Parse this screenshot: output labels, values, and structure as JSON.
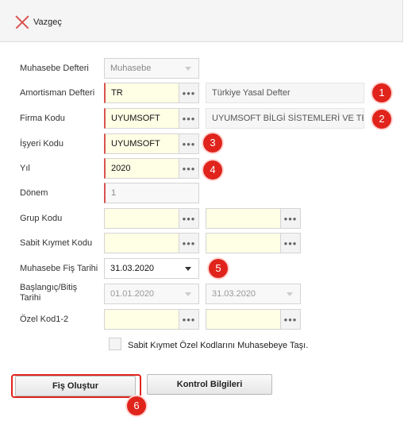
{
  "toolbar": {
    "cancel_label": "Vazgeç"
  },
  "form": {
    "muhasebe_defteri": {
      "label": "Muhasebe Defteri",
      "value": "Muhasebe"
    },
    "amortisman_defteri": {
      "label": "Amortisman Defteri",
      "value": "TR",
      "description": "Türkiye Yasal Defter"
    },
    "firma_kodu": {
      "label": "Firma Kodu",
      "value": "UYUMSOFT",
      "description": "UYUMSOFT BİLGİ SİSTEMLERİ VE TEKNO"
    },
    "isyeri_kodu": {
      "label": "İşyeri Kodu",
      "value": "UYUMSOFT"
    },
    "yil": {
      "label": "Yıl",
      "value": "2020"
    },
    "donem": {
      "label": "Dönem",
      "value": "1"
    },
    "grup_kodu": {
      "label": "Grup Kodu"
    },
    "sabit_kiymet_kodu": {
      "label": "Sabit Kıymet Kodu"
    },
    "muhasebe_fis_tarihi": {
      "label": "Muhasebe Fiş Tarihi",
      "value": "31.03.2020"
    },
    "baslangic_bitis_tarihi": {
      "label": "Başlangıç/Bitiş Tarihi",
      "start": "01.01.2020",
      "end": "31.03.2020"
    },
    "ozel_kod": {
      "label": "Özel Kod1-2"
    },
    "checkbox_label": "Sabit Kıymet Özel Kodlarını Muhasebeye Taşı."
  },
  "buttons": {
    "create": "Fiş Oluştur",
    "control": "Kontrol Bilgileri"
  },
  "badges": [
    "1",
    "2",
    "3",
    "4",
    "5",
    "6"
  ],
  "colors": {
    "badge": "#e0241c",
    "required": "#d9534f",
    "input_yellow": "#ffffe6"
  }
}
